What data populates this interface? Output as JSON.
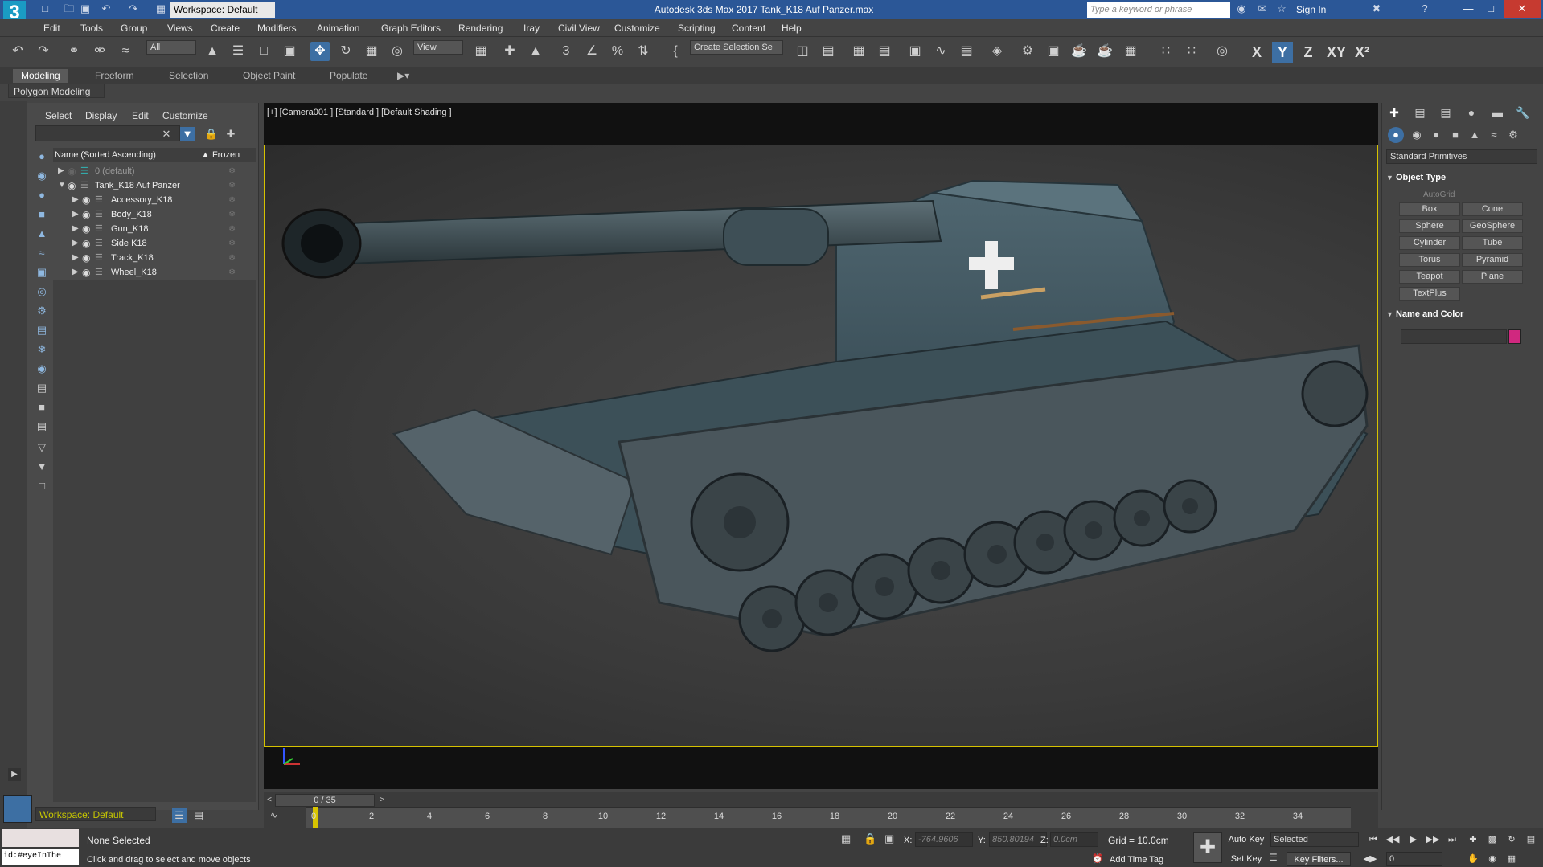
{
  "titlebar": {
    "logo": "3",
    "workspace": "Workspace: Default",
    "app_title": "Autodesk 3ds Max 2017    Tank_K18 Auf Panzer.max",
    "search_placeholder": "Type a keyword or phrase",
    "signin": "Sign In"
  },
  "menu": [
    "Edit",
    "Tools",
    "Group",
    "Views",
    "Create",
    "Modifiers",
    "Animation",
    "Graph Editors",
    "Rendering",
    "Iray",
    "Civil View",
    "Customize",
    "Scripting",
    "Content",
    "Help"
  ],
  "toolbar": {
    "filter": "All",
    "view": "View",
    "create_selection": "Create Selection Se",
    "axes": [
      "X",
      "Y",
      "Z",
      "XY",
      "X²"
    ]
  },
  "ribbon": {
    "tabs": [
      "Modeling",
      "Freeform",
      "Selection",
      "Object Paint",
      "Populate"
    ],
    "panel": "Polygon Modeling"
  },
  "scene_explorer": {
    "menu": [
      "Select",
      "Display",
      "Edit",
      "Customize"
    ],
    "col_name": "Name (Sorted Ascending)",
    "col_frozen": "▲ Frozen",
    "rows": [
      "0 (default)",
      "Tank_K18 Auf Panzer",
      "Accessory_K18",
      "Body_K18",
      "Gun_K18",
      "Side K18",
      "Track_K18",
      "Wheel_K18"
    ],
    "workspace": "Workspace: Default"
  },
  "viewport": {
    "label": "[+] [Camera001 ] [Standard ] [Default Shading ]"
  },
  "command_panel": {
    "dropdown": "Standard Primitives",
    "object_type": "Object Type",
    "autogrid": "AutoGrid",
    "primitives": [
      "Box",
      "Cone",
      "Sphere",
      "GeoSphere",
      "Cylinder",
      "Tube",
      "Torus",
      "Pyramid",
      "Teapot",
      "Plane",
      "TextPlus"
    ],
    "name_and_color": "Name and Color",
    "object_color": "#d0287f"
  },
  "timeline": {
    "slider": "0 / 35",
    "ticks": [
      "0",
      "2",
      "4",
      "6",
      "8",
      "10",
      "12",
      "14",
      "16",
      "18",
      "20",
      "22",
      "24",
      "26",
      "28",
      "30",
      "32",
      "34"
    ]
  },
  "status": {
    "maxscript": "id:#eyeInThe",
    "selection": "None Selected",
    "prompt": "Click and drag to select and move objects",
    "x_label": "X:",
    "x": "-764.9606",
    "y_label": "Y:",
    "y": "850.80194",
    "z_label": "Z:",
    "z": "0.0cm",
    "grid": "Grid = 10.0cm",
    "add_time_tag": "Add Time Tag",
    "auto_key": "Auto Key",
    "set_key": "Set Key",
    "selected": "Selected",
    "key_filters": "Key Filters...",
    "frame": "0"
  }
}
